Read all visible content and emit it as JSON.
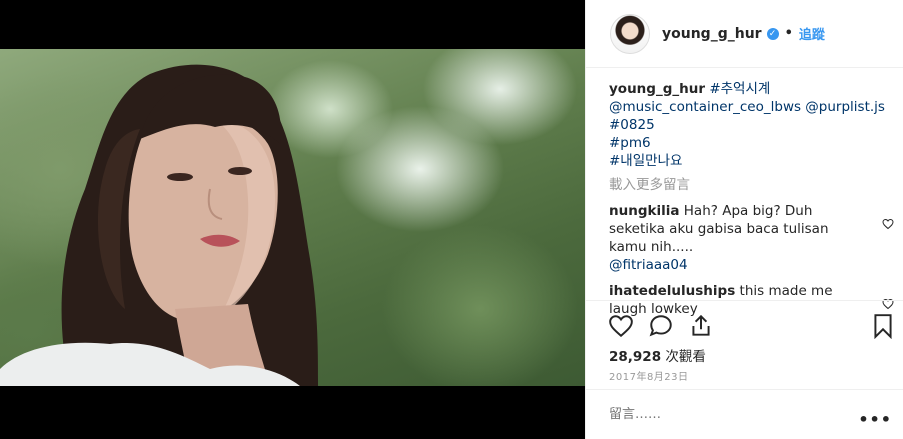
{
  "header": {
    "username": "young_g_hur",
    "verified_icon": "verified-badge-icon",
    "separator": "•",
    "follow_label": "追蹤"
  },
  "caption": {
    "username": "young_g_hur",
    "hashtag1": "#추억시계",
    "mentions": "@music_container_ceo_lbws @purplist.js",
    "hashtag2": "#0825",
    "hashtag3": "#pm6",
    "hashtag4": "#내일만나요"
  },
  "load_more": "載入更多留言",
  "comments": [
    {
      "username": "nungkilia",
      "text": "Hah? Apa big? Duh seketika aku gabisa baca tulisan kamu nih.....",
      "mention": "@fitriaaa04"
    },
    {
      "username": "ihatedeluluships",
      "text": "this made me laugh lowkey"
    }
  ],
  "views": {
    "count": "28,928",
    "label": "次觀看"
  },
  "date": "2017年8月23日",
  "add_comment": {
    "placeholder": "留言……"
  },
  "more_options": "•••",
  "colors": {
    "link": "#003569",
    "follow": "#3897f0",
    "muted": "#999999"
  }
}
